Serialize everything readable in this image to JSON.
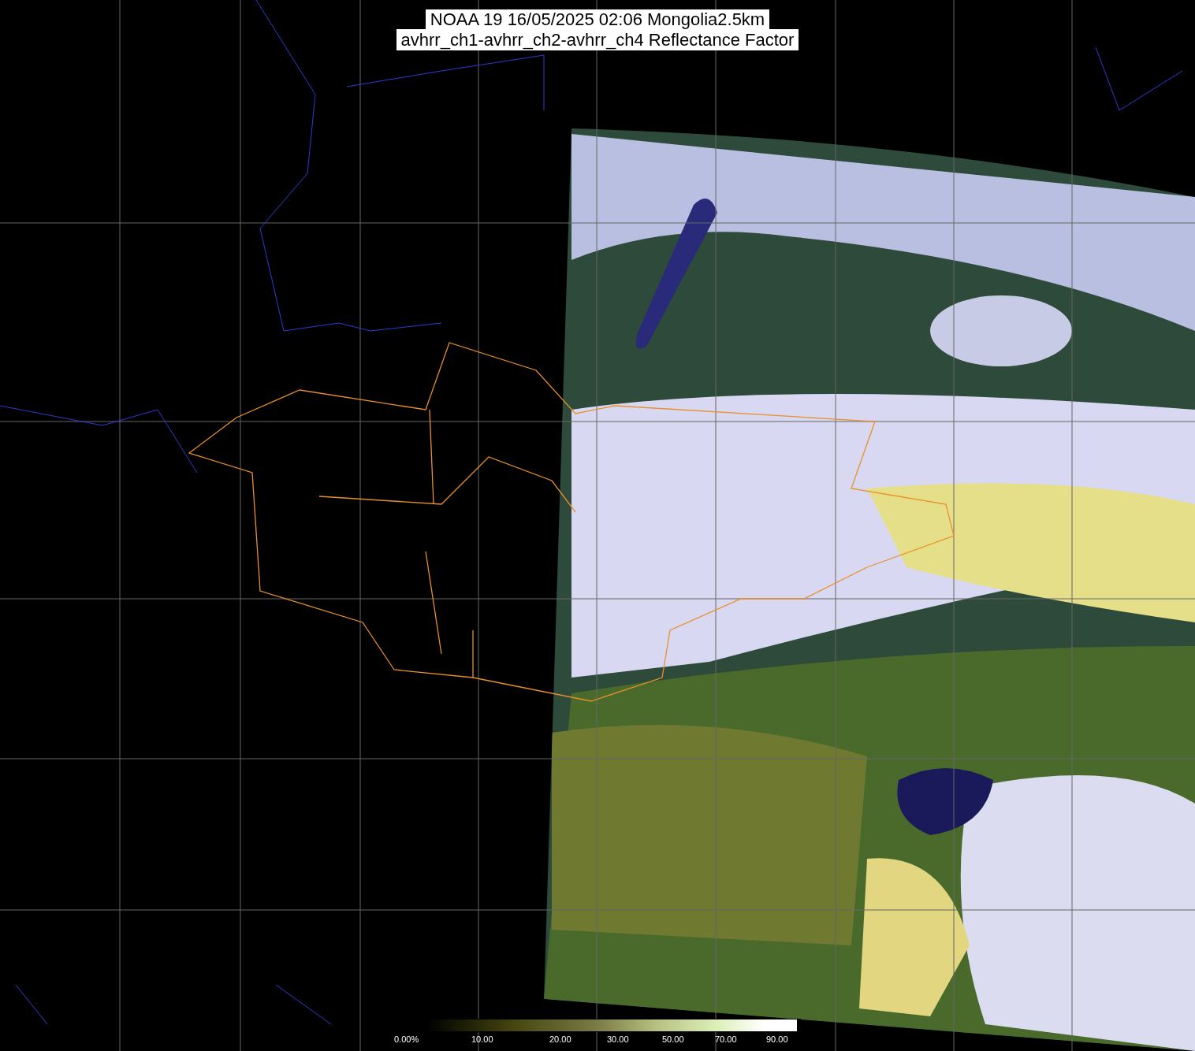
{
  "title": {
    "lines": [
      "NOAA 19 16/05/2025 02:06 Mongolia2.5km",
      "avhrr_ch1-avhrr_ch2-avhrr_ch4 Reflectance Factor"
    ]
  },
  "colorbar": {
    "labels": [
      "0.00%",
      "10.00",
      "20.00",
      "30.00",
      "50.00",
      "70.00",
      "90.00"
    ]
  }
}
